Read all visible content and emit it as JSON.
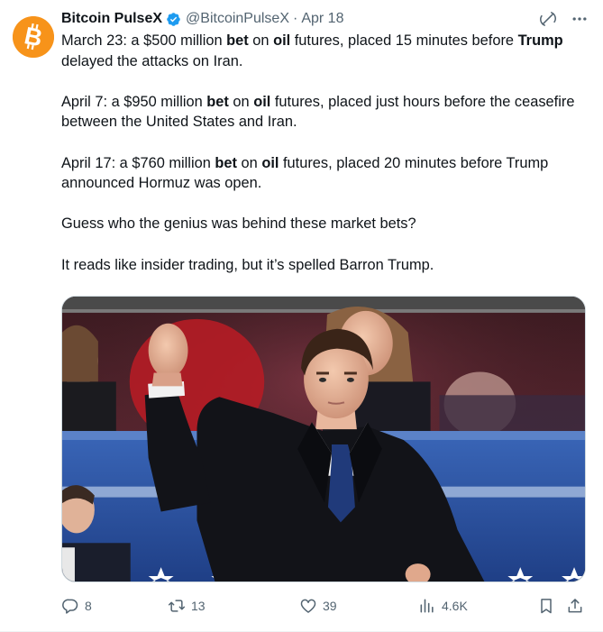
{
  "colors": {
    "text": "#0f1419",
    "muted": "#536471",
    "brand_orange": "#f7931a",
    "verified_blue": "#1d9bf0"
  },
  "author": {
    "name": "Bitcoin PulseX",
    "handle": "@BitcoinPulseX",
    "separator": "·",
    "date": "Apr 18",
    "avatar_icon": "bitcoin-logo",
    "verified_icon": "verified-badge-icon"
  },
  "header_icons": {
    "grok": "grok-icon",
    "more": "more-icon"
  },
  "tweet": {
    "p1": {
      "a": "March 23: a $500 million ",
      "b": "bet",
      "c": " on ",
      "d": "oil",
      "e": " futures, placed 15 minutes before ",
      "f": "Trump",
      "g": " delayed the attacks on Iran."
    },
    "p2": {
      "a": "April 7: a $950 million ",
      "b": "bet",
      "c": " on ",
      "d": "oil",
      "e": " futures, placed just hours before the ceasefire between the United States and Iran."
    },
    "p3": {
      "a": "April 17: a $760 million ",
      "b": "bet",
      "c": " on ",
      "d": "oil",
      "e": " futures, placed 20 minutes before Trump announced Hormuz was open."
    },
    "p4": "Guess who the genius was behind these market bets?",
    "p5": "It reads like insider trading, but it’s spelled Barron Trump."
  },
  "media": {
    "type": "photo"
  },
  "actions": {
    "replies": "8",
    "reposts": "13",
    "likes": "39",
    "views": "4.6K",
    "icons": [
      "reply-icon",
      "repost-icon",
      "like-icon",
      "views-icon",
      "bookmark-icon",
      "share-icon"
    ]
  }
}
